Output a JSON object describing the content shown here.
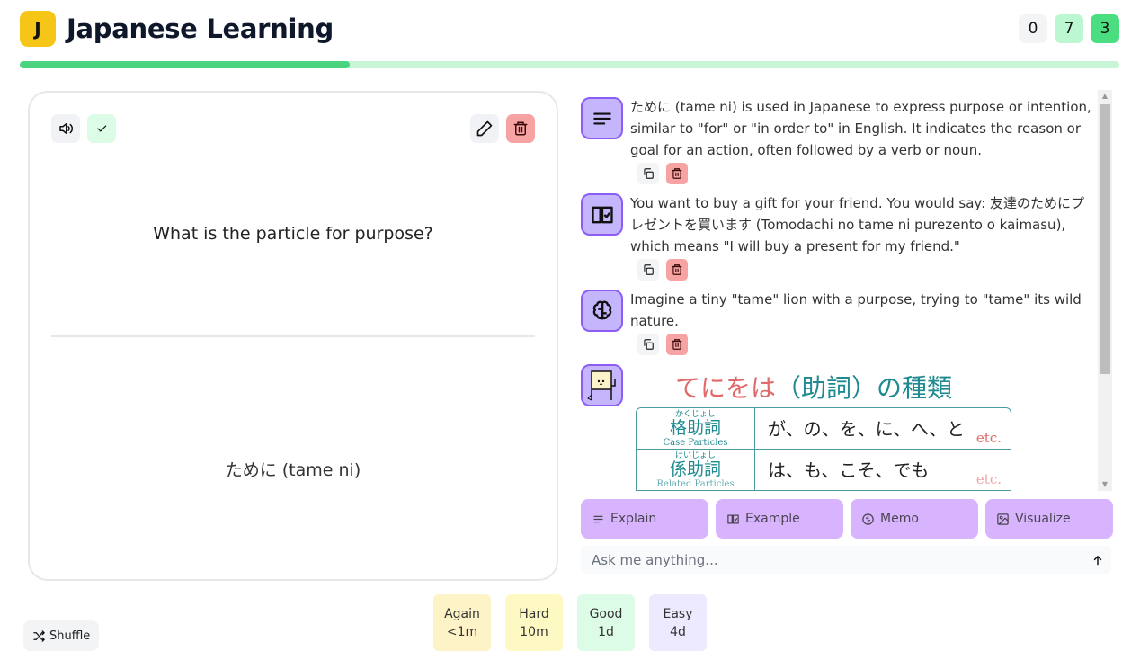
{
  "app": {
    "logo_letter": "J",
    "title": "Japanese Learning",
    "counters": [
      {
        "value": "0",
        "color": "#f3f4f6"
      },
      {
        "value": "7",
        "color": "#bbf7d0"
      },
      {
        "value": "3",
        "color": "#4ade80"
      }
    ],
    "progress_fraction": 0.3
  },
  "card": {
    "question": "What is the particle for purpose?",
    "answer": "ためにSPLIT(tame ni)",
    "answer_text": "ために (tame ni)",
    "tools": {
      "speaker_icon": "speaker-icon",
      "check_icon": "check-icon",
      "edit_icon": "pencil-icon",
      "delete_icon": "trash-icon"
    }
  },
  "chat": {
    "messages": [
      {
        "type": "explain",
        "icon": "align-left-icon",
        "text": "ために (tame ni) is used in Japanese to express purpose or intention, similar to \"for\" or \"in order to\" in English. It indicates the reason or goal for an action, often followed by a verb or noun."
      },
      {
        "type": "example",
        "icon": "book-check-icon",
        "text": "You want to buy a gift for your friend. You would say: 友達のためにプレゼントを買います (Tomodachi no tame ni purezento o kaimasu), which means \"I will buy a present for my friend.\""
      },
      {
        "type": "memo",
        "icon": "brain-icon",
        "text": "Imagine a tiny \"tame\" lion with a purpose, trying to \"tame\" its wild nature."
      },
      {
        "type": "visualize",
        "icon": "mascot-icon"
      }
    ],
    "image": {
      "title_pink": "てにをは",
      "title_teal": "（助詞）の種類",
      "rows": [
        {
          "ruby": "かくじょし",
          "kanji": "格助詞",
          "english": "Case Particles",
          "values": "が、の、を、に、へ、と",
          "etc": "etc."
        },
        {
          "ruby": "けいじょし",
          "kanji": "係助詞",
          "english": "Related Particles",
          "values": "は、も、こそ、でも",
          "etc": "etc."
        }
      ]
    }
  },
  "actions": {
    "quick": [
      {
        "label": "Explain",
        "icon": "align-left-icon"
      },
      {
        "label": "Example",
        "icon": "book-check-icon"
      },
      {
        "label": "Memo",
        "icon": "brain-icon"
      },
      {
        "label": "Visualize",
        "icon": "image-icon"
      }
    ],
    "ask_placeholder": "Ask me anything..."
  },
  "footer": {
    "shuffle_label": "Shuffle",
    "ratings": [
      {
        "label": "Again",
        "interval": "<1m",
        "color": "#fef3c7"
      },
      {
        "label": "Hard",
        "interval": "10m",
        "color": "#fef9c3"
      },
      {
        "label": "Good",
        "interval": "1d",
        "color": "#dcfce7"
      },
      {
        "label": "Easy",
        "interval": "4d",
        "color": "#ede9fe"
      }
    ]
  }
}
